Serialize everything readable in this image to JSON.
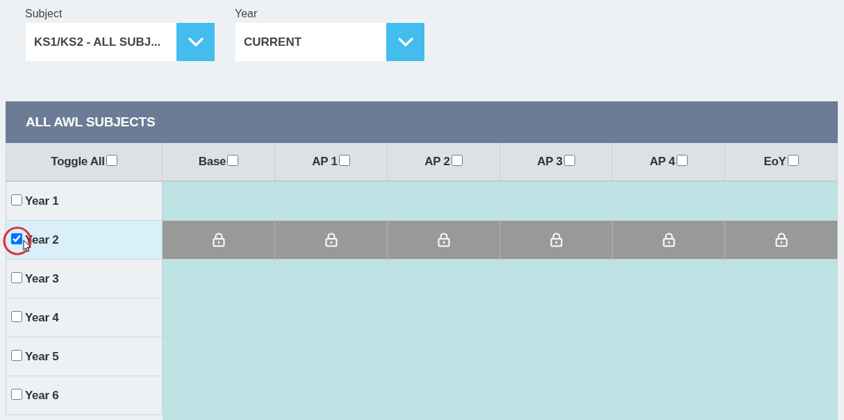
{
  "filters": [
    {
      "label": "Subject",
      "value": "KS1/KS2 - ALL SUBJ..."
    },
    {
      "label": "Year",
      "value": "CURRENT"
    }
  ],
  "table": {
    "title": "ALL AWL SUBJECTS",
    "toggle_all": {
      "label": "Toggle All",
      "checked": false
    },
    "columns": [
      {
        "label": "Base",
        "checked": false
      },
      {
        "label": "AP 1",
        "checked": false
      },
      {
        "label": "AP 2",
        "checked": false
      },
      {
        "label": "AP 3",
        "checked": false
      },
      {
        "label": "AP 4",
        "checked": false
      },
      {
        "label": "EoY",
        "checked": false
      }
    ],
    "rows": [
      {
        "label": "Year 1",
        "checked": false,
        "locked": false,
        "circled": false
      },
      {
        "label": "Year 2",
        "checked": true,
        "locked": true,
        "circled": true
      },
      {
        "label": "Year 3",
        "checked": false,
        "locked": false,
        "circled": false
      },
      {
        "label": "Year 4",
        "checked": false,
        "locked": false,
        "circled": false
      },
      {
        "label": "Year 5",
        "checked": false,
        "locked": false,
        "circled": false
      },
      {
        "label": "Year 6",
        "checked": false,
        "locked": false,
        "circled": false
      }
    ]
  }
}
